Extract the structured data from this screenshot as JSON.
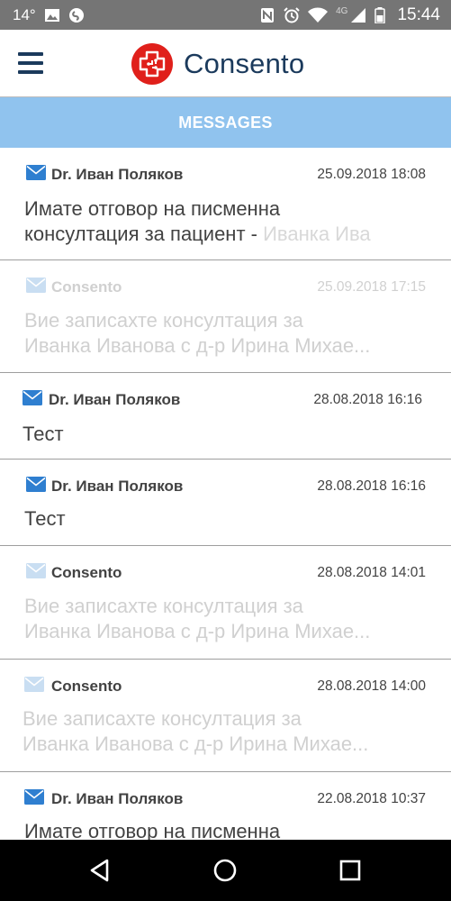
{
  "status_bar": {
    "temperature": "14°",
    "network": "4G",
    "time": "15:44"
  },
  "header": {
    "app_name": "Consento",
    "logo": "consento-cross-logo",
    "menu_icon": "hamburger-menu-icon"
  },
  "section": {
    "title": "MESSAGES"
  },
  "messages": [
    {
      "sender": "Dr. Иван Поляков",
      "date": "25.09.2018 18:08",
      "preview_line1": "Имате отговор на писменна",
      "preview_line2_main": "консултация за пациент - ",
      "preview_line2_tail": "Иванка Ива"
    },
    {
      "sender": "Consento",
      "date": "25.09.2018 17:15",
      "preview_line1": "Вие записахте консултация за",
      "preview_line2": "Иванка Иванова с д-р Ирина Михае..."
    },
    {
      "sender": "Dr. Иван Поляков",
      "date": "28.08.2018 16:16",
      "preview_line1": "Тест"
    },
    {
      "sender": "Dr. Иван Поляков",
      "date": "28.08.2018 16:16",
      "preview_line1": "Тест"
    },
    {
      "sender": "Consento",
      "date": "28.08.2018 14:01",
      "preview_line1": "Вие записахте консултация за",
      "preview_line2": "Иванка Иванова с д-р Ирина Михае..."
    },
    {
      "sender": "Consento",
      "date": "28.08.2018 14:00",
      "preview_line1": "Вие записахте консултация за",
      "preview_line2": "Иванка Иванова с д-р Ирина Михае..."
    },
    {
      "sender": "Dr. Иван Поляков",
      "date": "22.08.2018 10:37",
      "preview_line1": "Имате отговор на писменна"
    }
  ],
  "colors": {
    "brand_navy": "#1b3a5c",
    "brand_red": "#e0201b",
    "section_band": "#90c3ee",
    "envelope_blue": "#2f7fd0",
    "status_bar": "#757575"
  }
}
